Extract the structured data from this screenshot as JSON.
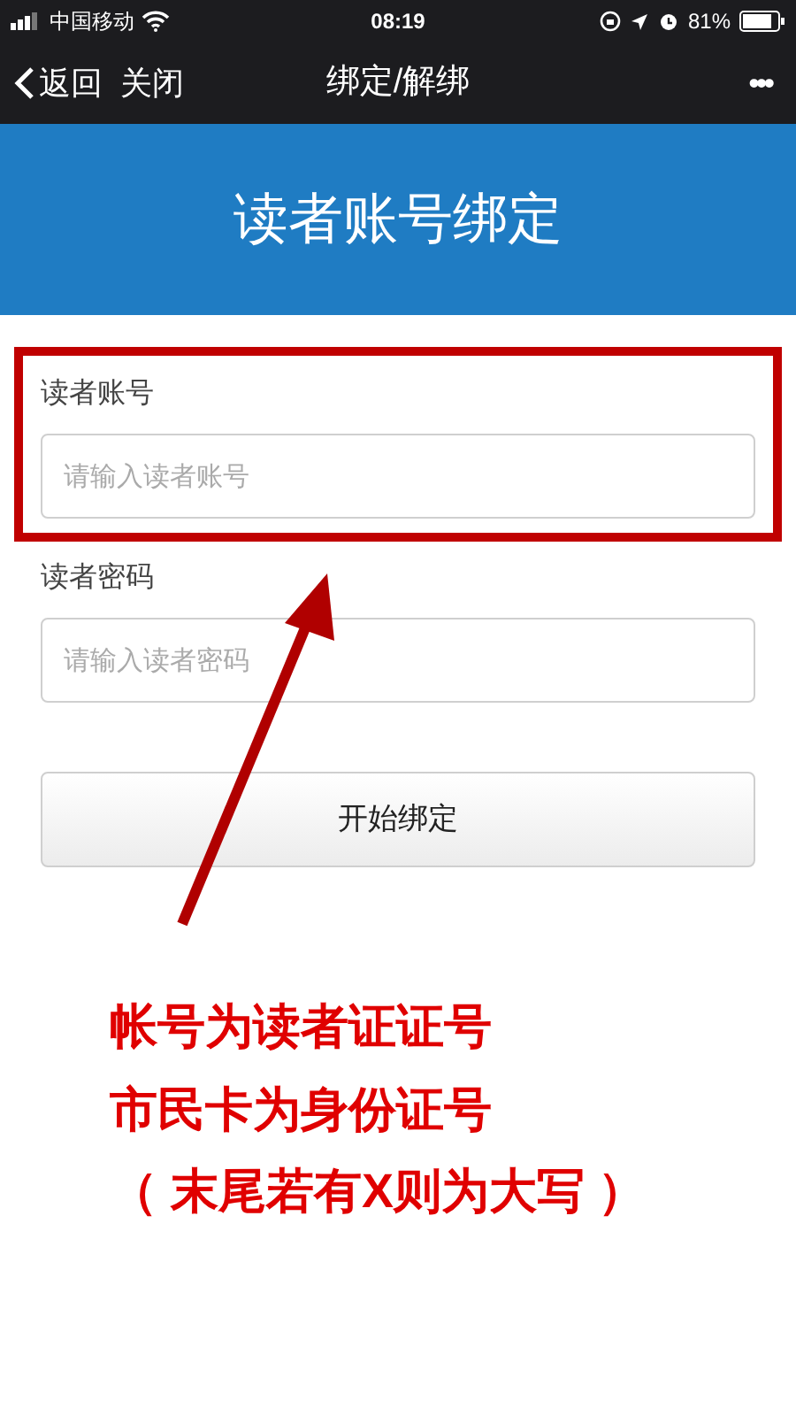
{
  "status_bar": {
    "carrier": "中国移动",
    "time": "08:19",
    "battery": "81%"
  },
  "nav_bar": {
    "back": "返回",
    "close": "关闭",
    "title": "绑定/解绑",
    "more": "•••"
  },
  "header": {
    "title": "读者账号绑定"
  },
  "form": {
    "fields": [
      {
        "label": "读者账号",
        "placeholder": "请输入读者账号",
        "highlighted": true
      },
      {
        "label": "读者密码",
        "placeholder": "请输入读者密码",
        "highlighted": false
      }
    ],
    "submit": "开始绑定"
  },
  "annotation": {
    "lines": [
      "帐号为读者证证号",
      "市民卡为身份证号",
      "（ 末尾若有X则为大写 ）"
    ]
  }
}
